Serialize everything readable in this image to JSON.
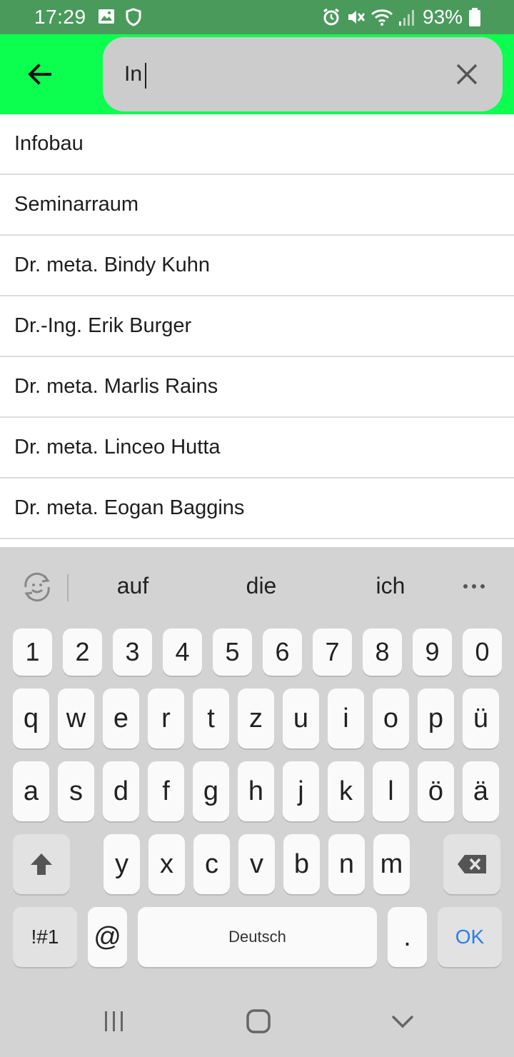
{
  "status_bar": {
    "time": "17:29",
    "battery": "93%",
    "icons": [
      "gallery-icon",
      "shield-icon",
      "alarm-icon",
      "mute-icon",
      "wifi-icon",
      "signal-icon",
      "battery-icon"
    ]
  },
  "search": {
    "value": "In",
    "colors": {
      "app_bar": "#0cff4e",
      "search_box": "#cccccc",
      "status_bar": "#4a9a5c"
    }
  },
  "results": [
    "Infobau",
    "Seminarraum",
    "Dr. meta. Bindy Kuhn",
    "Dr.-Ing. Erik Burger",
    "Dr. meta. Marlis Rains",
    "Dr. meta. Linceo Hutta",
    "Dr. meta. Eogan Baggins"
  ],
  "keyboard": {
    "suggestions": [
      "auf",
      "die",
      "ich"
    ],
    "number_row": [
      "1",
      "2",
      "3",
      "4",
      "5",
      "6",
      "7",
      "8",
      "9",
      "0"
    ],
    "row1": [
      "q",
      "w",
      "e",
      "r",
      "t",
      "z",
      "u",
      "i",
      "o",
      "p",
      "ü"
    ],
    "row2": [
      "a",
      "s",
      "d",
      "f",
      "g",
      "h",
      "j",
      "k",
      "l",
      "ö",
      "ä"
    ],
    "row3": [
      "y",
      "x",
      "c",
      "v",
      "b",
      "n",
      "m"
    ],
    "symbols_label": "!#1",
    "at_label": "@",
    "space_label": "Deutsch",
    "period_label": ".",
    "ok_label": "OK",
    "ok_color": "#2b7de9"
  }
}
